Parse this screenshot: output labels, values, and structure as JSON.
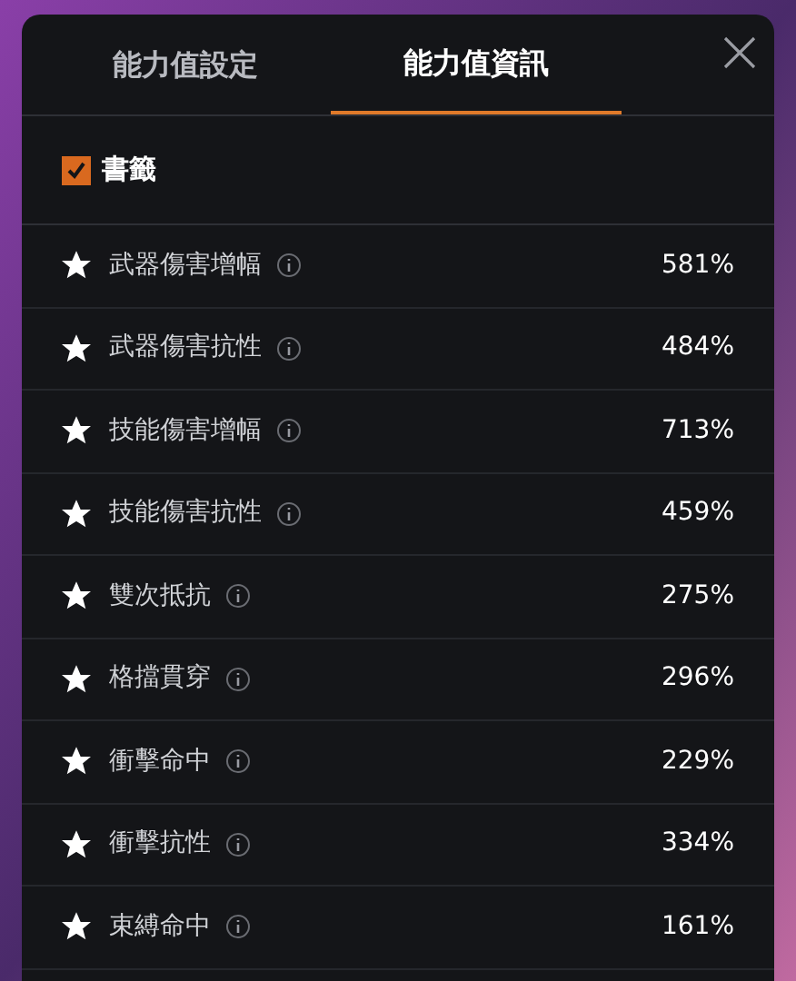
{
  "tabs": [
    {
      "label": "能力值設定",
      "selected": false
    },
    {
      "label": "能力值資訊",
      "selected": true
    }
  ],
  "filter": {
    "label": "書籤",
    "checked": true
  },
  "stats": [
    {
      "name": "武器傷害增幅",
      "value": "581%",
      "starred": true
    },
    {
      "name": "武器傷害抗性",
      "value": "484%",
      "starred": true
    },
    {
      "name": "技能傷害增幅",
      "value": "713%",
      "starred": true
    },
    {
      "name": "技能傷害抗性",
      "value": "459%",
      "starred": true
    },
    {
      "name": "雙次抵抗",
      "value": "275%",
      "starred": true
    },
    {
      "name": "格擋貫穿",
      "value": "296%",
      "starred": true
    },
    {
      "name": "衝擊命中",
      "value": "229%",
      "starred": true
    },
    {
      "name": "衝擊抗性",
      "value": "334%",
      "starred": true
    },
    {
      "name": "束縛命中",
      "value": "161%",
      "starred": true
    }
  ]
}
